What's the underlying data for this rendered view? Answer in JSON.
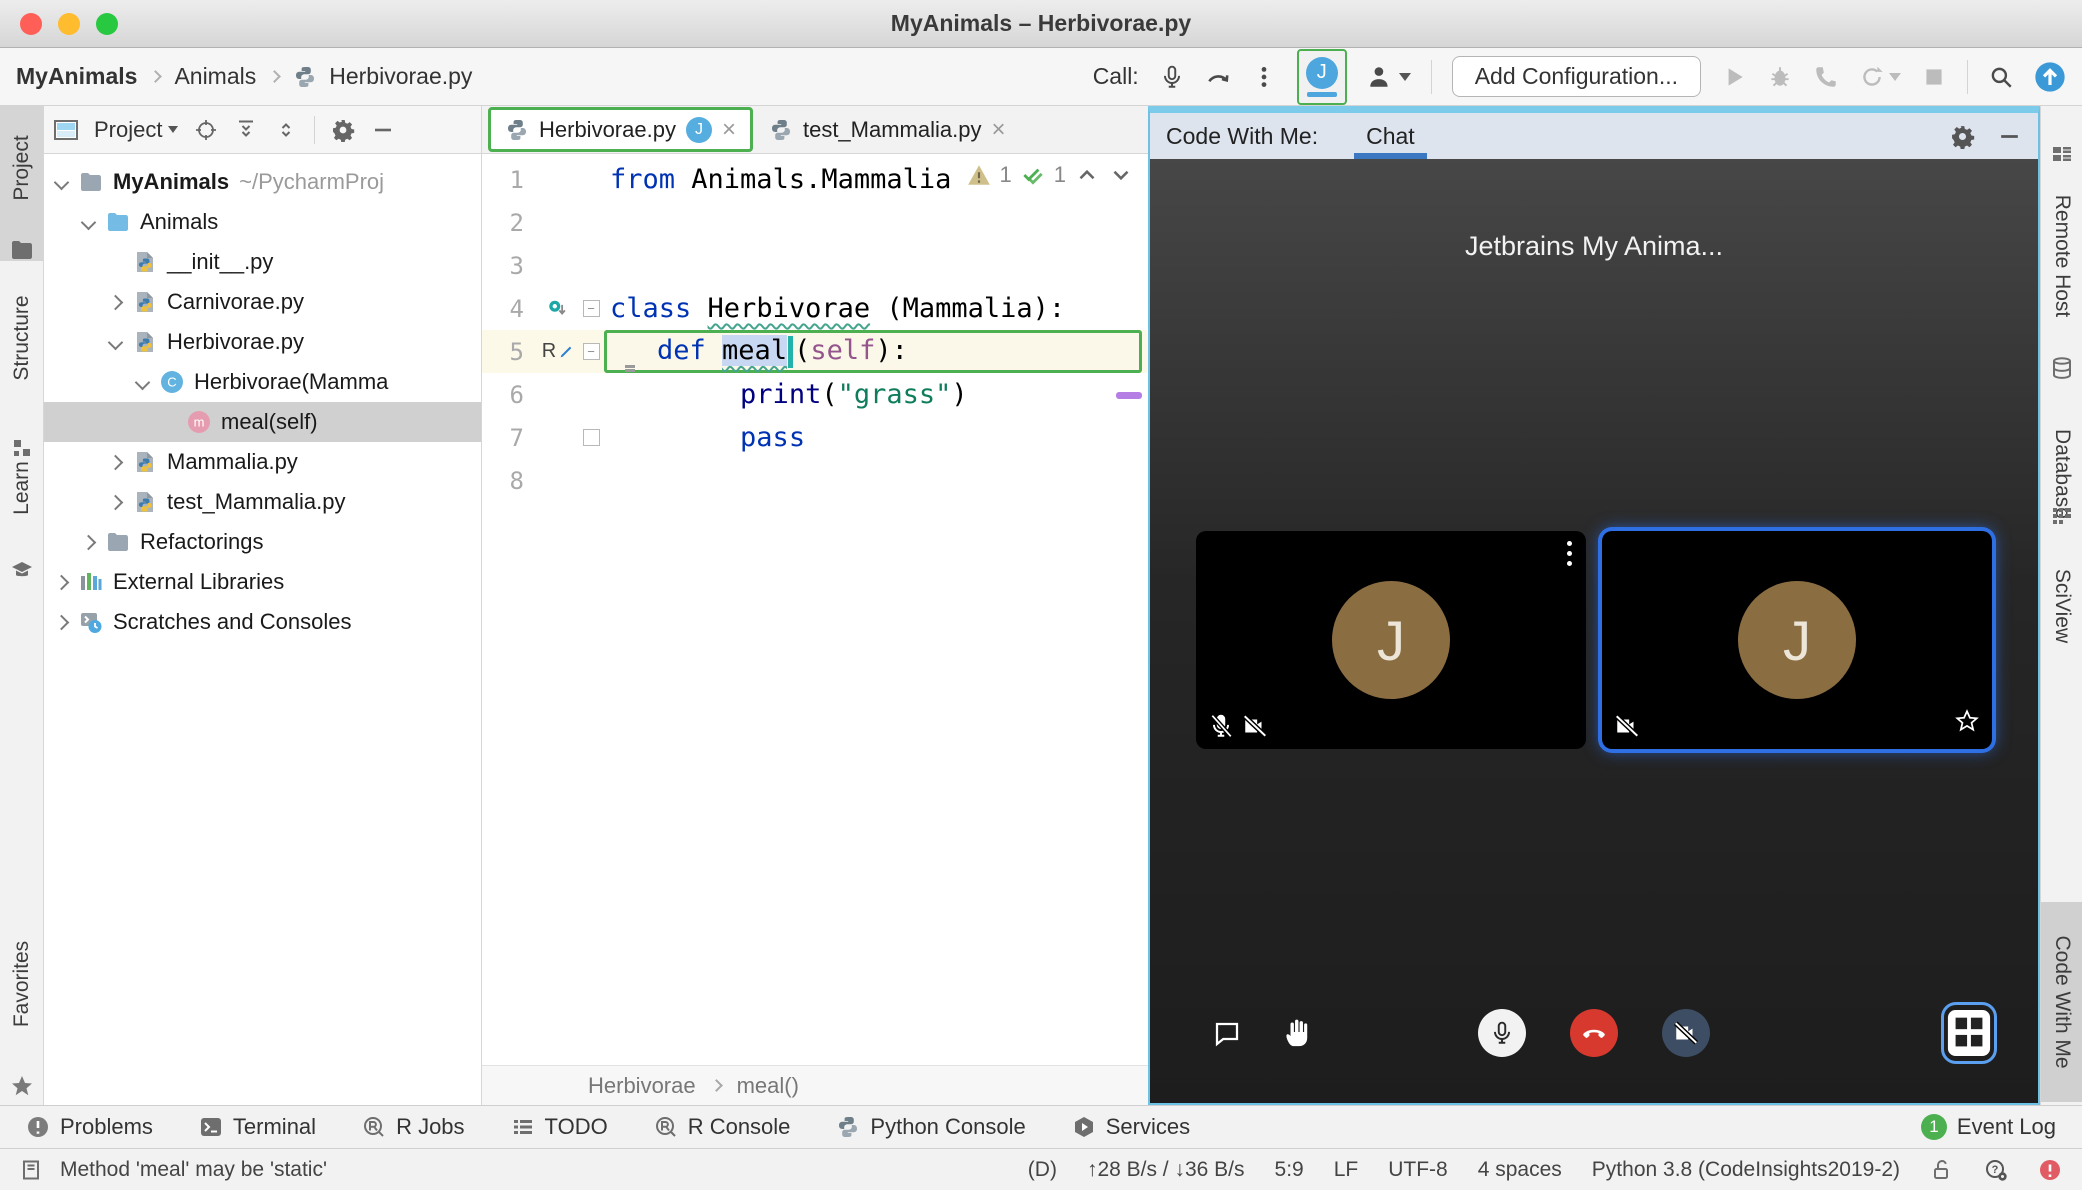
{
  "window": {
    "title": "MyAnimals – Herbivorae.py"
  },
  "toolbar": {
    "breadcrumb": [
      "MyAnimals",
      "Animals",
      "Herbivorae.py"
    ],
    "call_label": "Call:",
    "avatar_initial": "J",
    "add_configuration_label": "Add Configuration..."
  },
  "left_stripe": [
    {
      "label": "Project",
      "icon": "folder",
      "selected": true
    },
    {
      "label": "Structure",
      "icon": "structure"
    },
    {
      "label": "Learn",
      "icon": "learn"
    },
    {
      "label": "Favorites",
      "icon": "star"
    }
  ],
  "project_panel": {
    "header_label": "Project",
    "tree": [
      {
        "label": "MyAnimals",
        "suffix": "~/PycharmProj",
        "icon": "folder-gray",
        "chevron": "down",
        "bold": true,
        "indent": 0
      },
      {
        "label": "Animals",
        "icon": "folder-blue",
        "chevron": "down",
        "indent": 1
      },
      {
        "label": "__init__.py",
        "icon": "pyfile",
        "chevron": "none",
        "indent": 2
      },
      {
        "label": "Carnivorae.py",
        "icon": "pyfile",
        "chevron": "right",
        "indent": 2
      },
      {
        "label": "Herbivorae.py",
        "icon": "pyfile",
        "chevron": "down",
        "indent": 2
      },
      {
        "label": "Herbivorae(Mamma",
        "icon": "class",
        "chevron": "down",
        "indent": 3
      },
      {
        "label": "meal(self)",
        "icon": "method",
        "chevron": "none",
        "indent": 4,
        "selected": true
      },
      {
        "label": "Mammalia.py",
        "icon": "pyfile",
        "chevron": "right",
        "indent": 2
      },
      {
        "label": "test_Mammalia.py",
        "icon": "pyfile",
        "chevron": "right",
        "indent": 2
      },
      {
        "label": "Refactorings",
        "icon": "folder-gray",
        "chevron": "right",
        "indent": 1
      },
      {
        "label": "External Libraries",
        "icon": "libraries",
        "chevron": "right",
        "indent": 0
      },
      {
        "label": "Scratches and Consoles",
        "icon": "scratches",
        "chevron": "right",
        "indent": 0
      }
    ]
  },
  "editor": {
    "tabs": [
      {
        "label": "Herbivorae.py",
        "badge": "J",
        "followed": true
      },
      {
        "label": "test_Mammalia.py"
      }
    ],
    "inspections": {
      "warning_count": "1",
      "ok_count": "1"
    },
    "lines": [
      {
        "n": "1",
        "tokens": [
          {
            "t": "from",
            "c": "kw"
          },
          {
            "t": " Animals.Mammalia",
            "c": "pl"
          }
        ]
      },
      {
        "n": "2",
        "tokens": []
      },
      {
        "n": "3",
        "tokens": []
      },
      {
        "n": "4",
        "gutter": "override",
        "fold": "minus",
        "tokens": [
          {
            "t": "class",
            "c": "kw"
          },
          {
            "t": " ",
            "c": "pl"
          },
          {
            "t": "Herbivorae",
            "c": "pl decl"
          },
          {
            "t": " (Mammalia):",
            "c": "pl"
          }
        ]
      },
      {
        "n": "5",
        "gutter": "rename",
        "fold": "minus",
        "highlight": true,
        "bulb": true,
        "tokens": [
          {
            "t": "def",
            "c": "kw"
          },
          {
            "t": " ",
            "c": "pl"
          },
          {
            "t": "meal",
            "c": "pl decl sel",
            "caret": true
          },
          {
            "t": "(",
            "c": "pl"
          },
          {
            "t": "self",
            "c": "slf"
          },
          {
            "t": "):",
            "c": "pl"
          }
        ]
      },
      {
        "n": "6",
        "tokens": [
          {
            "t": "        ",
            "c": "pl"
          },
          {
            "t": "print",
            "c": "bi"
          },
          {
            "t": "(",
            "c": "pl"
          },
          {
            "t": "\"grass\"",
            "c": "str"
          },
          {
            "t": ")",
            "c": "pl"
          }
        ]
      },
      {
        "n": "7",
        "fold": "end",
        "tokens": [
          {
            "t": "        ",
            "c": "pl"
          },
          {
            "t": "pass",
            "c": "kw"
          }
        ]
      },
      {
        "n": "8",
        "tokens": []
      }
    ],
    "breadcrumb": [
      "Herbivorae",
      "meal()"
    ]
  },
  "code_with_me": {
    "header_label": "Code With Me:",
    "tab_label": "Chat",
    "session_title": "Jetbrains My Anima...",
    "tiles": [
      {
        "initial": "J",
        "menu": true,
        "mic_off": true,
        "cam_off": true
      },
      {
        "initial": "J",
        "active": true,
        "cam_off": true,
        "star": true
      }
    ]
  },
  "right_stripe": [
    {
      "label": "Remote Host",
      "icon": "server"
    },
    {
      "label": "Database",
      "icon": "database"
    },
    {
      "label": "SciView",
      "icon": "sciview"
    },
    {
      "label": "Code With Me",
      "selected": true
    }
  ],
  "bottom_bar": {
    "items": [
      {
        "label": "Problems",
        "icon": "problems"
      },
      {
        "label": "Terminal",
        "icon": "terminal"
      },
      {
        "label": "R Jobs",
        "icon": "rcircle"
      },
      {
        "label": "TODO",
        "icon": "todo"
      },
      {
        "label": "R Console",
        "icon": "rcircle"
      },
      {
        "label": "Python Console",
        "icon": "python"
      },
      {
        "label": "Services",
        "icon": "services"
      }
    ],
    "event_log": {
      "label": "Event Log",
      "badge": "1"
    }
  },
  "status_bar": {
    "message": "Method 'meal' may be 'static'",
    "segments": [
      "(D)",
      "↑28 B/s / ↓36 B/s",
      "5:9",
      "LF",
      "UTF-8",
      "4 spaces",
      "Python 3.8 (CodeInsights2019-2)"
    ]
  },
  "colors": {
    "accent_blue": "#4da6dd",
    "follow_green": "#4caf50",
    "call_red": "#d7392e"
  }
}
